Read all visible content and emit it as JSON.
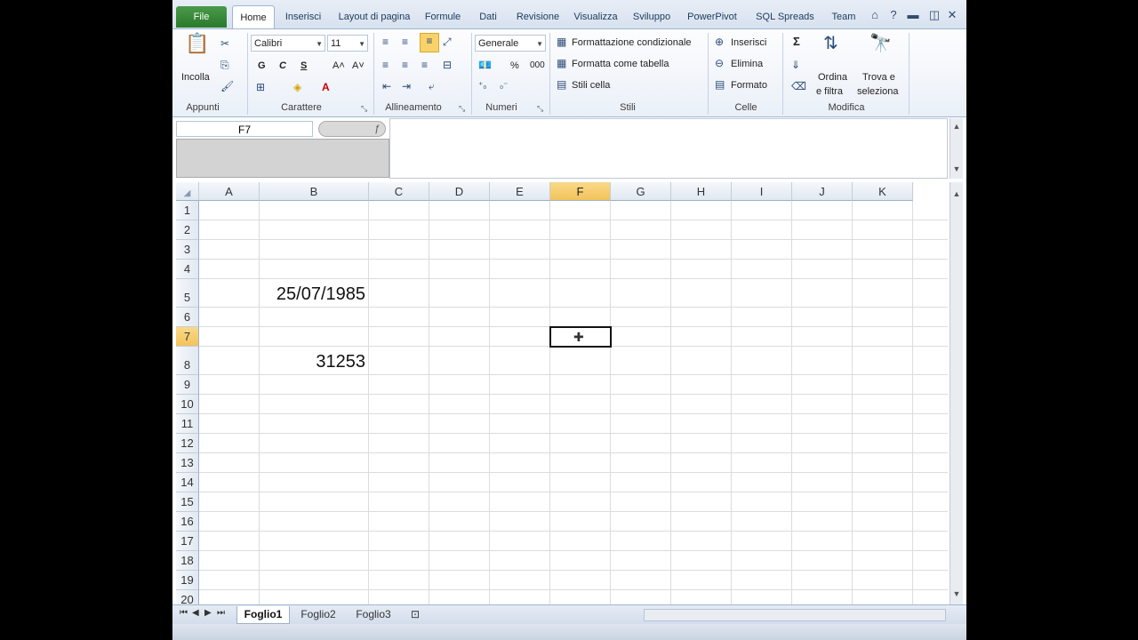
{
  "tabs": [
    "File",
    "Home",
    "Inserisci",
    "Layout di pagina",
    "Formule",
    "Dati",
    "Revisione",
    "Visualizza",
    "Sviluppo",
    "PowerPivot",
    "SQL Spreads",
    "Team"
  ],
  "ribbon": {
    "appunti": {
      "label": "Appunti",
      "paste": "Incolla"
    },
    "carattere": {
      "label": "Carattere",
      "font": "Calibri",
      "size": "11",
      "bold": "G",
      "italic": "C",
      "underline": "S",
      "grow": "A˄",
      "shrink": "A˅"
    },
    "allineamento": {
      "label": "Allineamento"
    },
    "numeri": {
      "label": "Numeri",
      "format": "Generale",
      "percent": "%",
      "thousands": "000"
    },
    "stili": {
      "label": "Stili",
      "cond": "Formattazione condizionale",
      "table": "Formatta come tabella",
      "cell": "Stili cella"
    },
    "celle": {
      "label": "Celle",
      "insert": "Inserisci",
      "delete": "Elimina",
      "format": "Formato"
    },
    "modifica": {
      "label": "Modifica",
      "sum": "Σ",
      "sort1": "Ordina",
      "sort2": "e filtra",
      "find1": "Trova e",
      "find2": "seleziona"
    }
  },
  "namebox": "F7",
  "columns": [
    "A",
    "B",
    "C",
    "D",
    "E",
    "F",
    "G",
    "H",
    "I",
    "J",
    "K"
  ],
  "rows": [
    "1",
    "2",
    "3",
    "4",
    "5",
    "6",
    "7",
    "8",
    "9",
    "10",
    "11",
    "12",
    "13",
    "14",
    "15",
    "16",
    "17",
    "18",
    "19",
    "20"
  ],
  "cells": {
    "B5": "25/07/1985",
    "B8": "31253"
  },
  "sheets": [
    "Foglio1",
    "Foglio2",
    "Foglio3"
  ]
}
